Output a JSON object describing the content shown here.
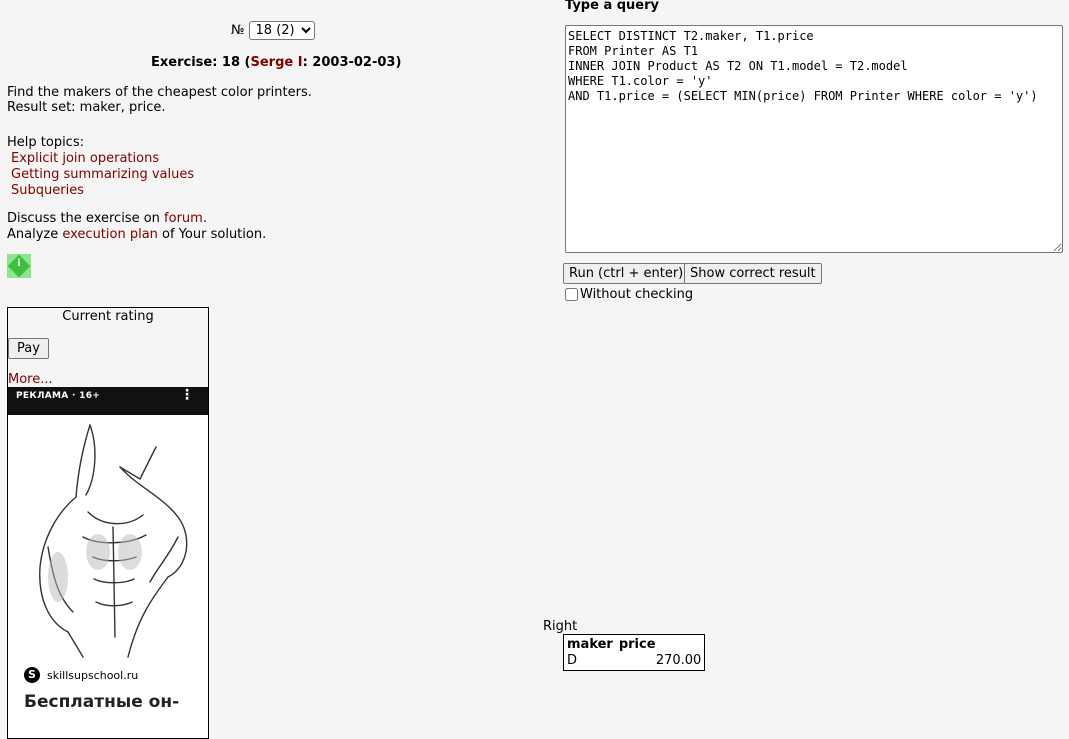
{
  "exercise_selector": {
    "prefix": "№",
    "selected": "18 (2)"
  },
  "exercise": {
    "label": "Exercise: 18",
    "open_paren": " (",
    "author": "Serge I",
    "date": ": 2003-02-03)",
    "task_line1": "Find the makers of the cheapest color printers.",
    "task_line2": "Result set: maker, price."
  },
  "help": {
    "heading": "Help topics:",
    "topics": [
      "Explicit join operations",
      "Getting summarizing values",
      "Subqueries"
    ]
  },
  "discuss": {
    "pre": "Discuss the exercise on ",
    "forum_link": "forum",
    "post": ".",
    "analyze_pre": "Analyze ",
    "plan_link": "execution plan",
    "analyze_post": " of Your solution."
  },
  "info_icon": {
    "glyph": "i",
    "name": "info-icon"
  },
  "rating": {
    "caption": "Current rating",
    "pay_label": "Pay",
    "more_link": "More..."
  },
  "ad": {
    "badge": "РЕКЛАМА · 16+",
    "menu_glyph": "⋮",
    "site_icon": "S",
    "site": "skillsupschool.ru",
    "headline": "Бесплатные он-"
  },
  "query": {
    "label": "Type a query",
    "text": "SELECT DISTINCT T2.maker, T1.price\nFROM Printer AS T1\nINNER JOIN Product AS T2 ON T1.model = T2.model\nWHERE T1.color = 'y'\nAND T1.price = (SELECT MIN(price) FROM Printer WHERE color = 'y')"
  },
  "actions": {
    "run_label": "Run (ctrl + enter)",
    "show_label": "Show correct result",
    "nocheck_label": "Without checking",
    "nocheck_checked": false
  },
  "result": {
    "label": "Right",
    "columns": [
      "maker",
      "price"
    ],
    "rows": [
      [
        "D",
        "270.00"
      ]
    ]
  }
}
